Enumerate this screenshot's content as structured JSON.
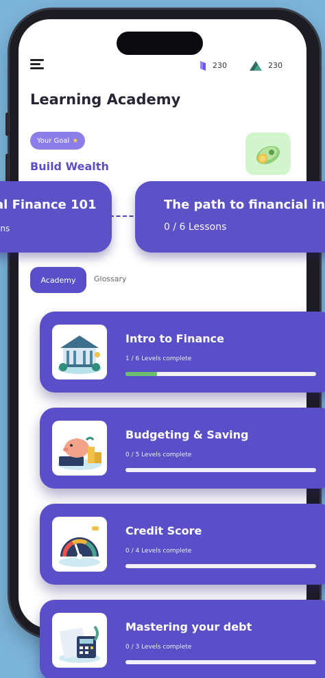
{
  "header": {
    "menu_icon": "hamburger-icon",
    "gems": {
      "icon": "gem-icon",
      "count": "230",
      "color": "#6a5ae0"
    },
    "points": {
      "icon": "mountain-icon",
      "count": "230"
    }
  },
  "page_title": "Learning Academy",
  "goal": {
    "badge_label": "Your Goal",
    "badge_icon": "star-icon",
    "title": "Build Wealth",
    "tile_icon": "money-icon"
  },
  "course_path": [
    {
      "title": "al Finance 101",
      "progress": "ons"
    },
    {
      "title": "The path to financial in",
      "progress": "0 / 6 Lessons"
    }
  ],
  "tabs": [
    {
      "label": "Academy",
      "active": true
    },
    {
      "label": "Glossary",
      "active": false
    }
  ],
  "lessons": [
    {
      "title": "Intro to Finance",
      "status": "1 / 6 Levels complete",
      "progress_fraction": 0.167,
      "icon": "bank-building-icon"
    },
    {
      "title": "Budgeting & Saving",
      "status": "0 / 5 Levels complete",
      "progress_fraction": 0,
      "icon": "piggy-bank-icon"
    },
    {
      "title": "Credit Score",
      "status": "0 / 4 Levels complete",
      "progress_fraction": 0,
      "icon": "credit-gauge-icon"
    },
    {
      "title": "Mastering your debt",
      "status": "0 / 3 Levels complete",
      "progress_fraction": 0,
      "icon": "calculator-icon"
    }
  ],
  "colors": {
    "background": "#7bb3d9",
    "accent": "#5a4fc9",
    "progress": "#6fbf73",
    "goal_tile": "#d2f5cd"
  }
}
